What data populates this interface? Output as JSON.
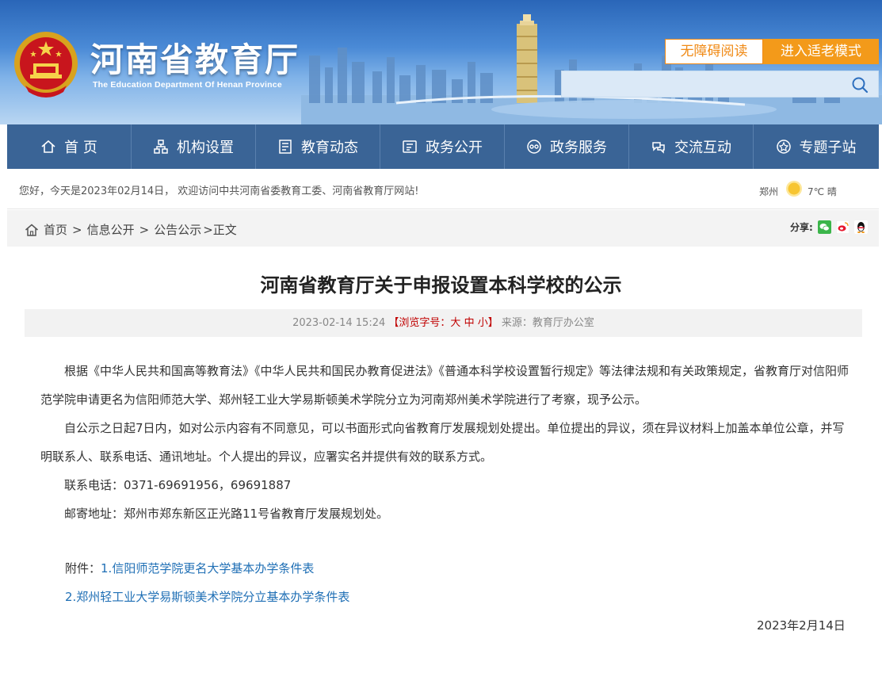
{
  "header": {
    "title": "河南省教育厅",
    "subtitle": "The Education Department Of Henan Province",
    "accessibility_label": "无障碍阅读",
    "elder_mode_label": "进入适老模式",
    "search_placeholder": "",
    "colors": {
      "orange": "#f39a1a",
      "nav_blue": "#3a6496"
    }
  },
  "nav": {
    "items": [
      {
        "label": "首 页",
        "icon": "home-icon"
      },
      {
        "label": "机构设置",
        "icon": "org-icon"
      },
      {
        "label": "教育动态",
        "icon": "news-icon"
      },
      {
        "label": "政务公开",
        "icon": "document-icon"
      },
      {
        "label": "政务服务",
        "icon": "service-icon"
      },
      {
        "label": "交流互动",
        "icon": "interaction-icon"
      },
      {
        "label": "专题子站",
        "icon": "topic-icon"
      }
    ]
  },
  "welcome": {
    "text": "您好，今天是2023年02月14日， 欢迎访问中共河南省委教育工委、河南省教育厅网站!",
    "city": "郑州",
    "weather": "7℃ 晴",
    "weather_icon": "sun-icon"
  },
  "breadcrumb": {
    "home": "首页",
    "sep1": ">",
    "level1": "信息公开",
    "sep2": ">",
    "level2": "公告公示",
    "current": ">正文"
  },
  "share": {
    "label": "分享:",
    "icons": [
      "wechat-icon",
      "weibo-icon",
      "qq-icon"
    ]
  },
  "article": {
    "title": "河南省教育厅关于申报设置本科学校的公示",
    "datetime": "2023-02-14 15:24",
    "fontsize_prefix": "【浏览字号：",
    "fontsize_large": "大",
    "fontsize_medium": "中",
    "fontsize_small": "小",
    "fontsize_suffix": "】",
    "source": "来源：教育厅办公室",
    "para1": "根据《中华人民共和国高等教育法》《中华人民共和国民办教育促进法》《普通本科学校设置暂行规定》等法律法规和有关政策规定，省教育厅对信阳师范学院申请更名为信阳师范大学、郑州轻工业大学易斯顿美术学院分立为河南郑州美术学院进行了考察，现予公示。",
    "para2": "自公示之日起7日内，如对公示内容有不同意见，可以书面形式向省教育厅发展规划处提出。单位提出的异议，须在异议材料上加盖本单位公章，并写明联系人、联系电话、通讯地址。个人提出的异议，应署实名并提供有效的联系方式。",
    "phone": "联系电话：0371-69691956，69691887",
    "address": "邮寄地址：郑州市郑东新区正光路11号省教育厅发展规划处。",
    "attach_label": "附件：",
    "attach1": "1.信阳师范学院更名大学基本办学条件表",
    "attach2": "2.郑州轻工业大学易斯顿美术学院分立基本办学条件表",
    "date": "2023年2月14日"
  }
}
